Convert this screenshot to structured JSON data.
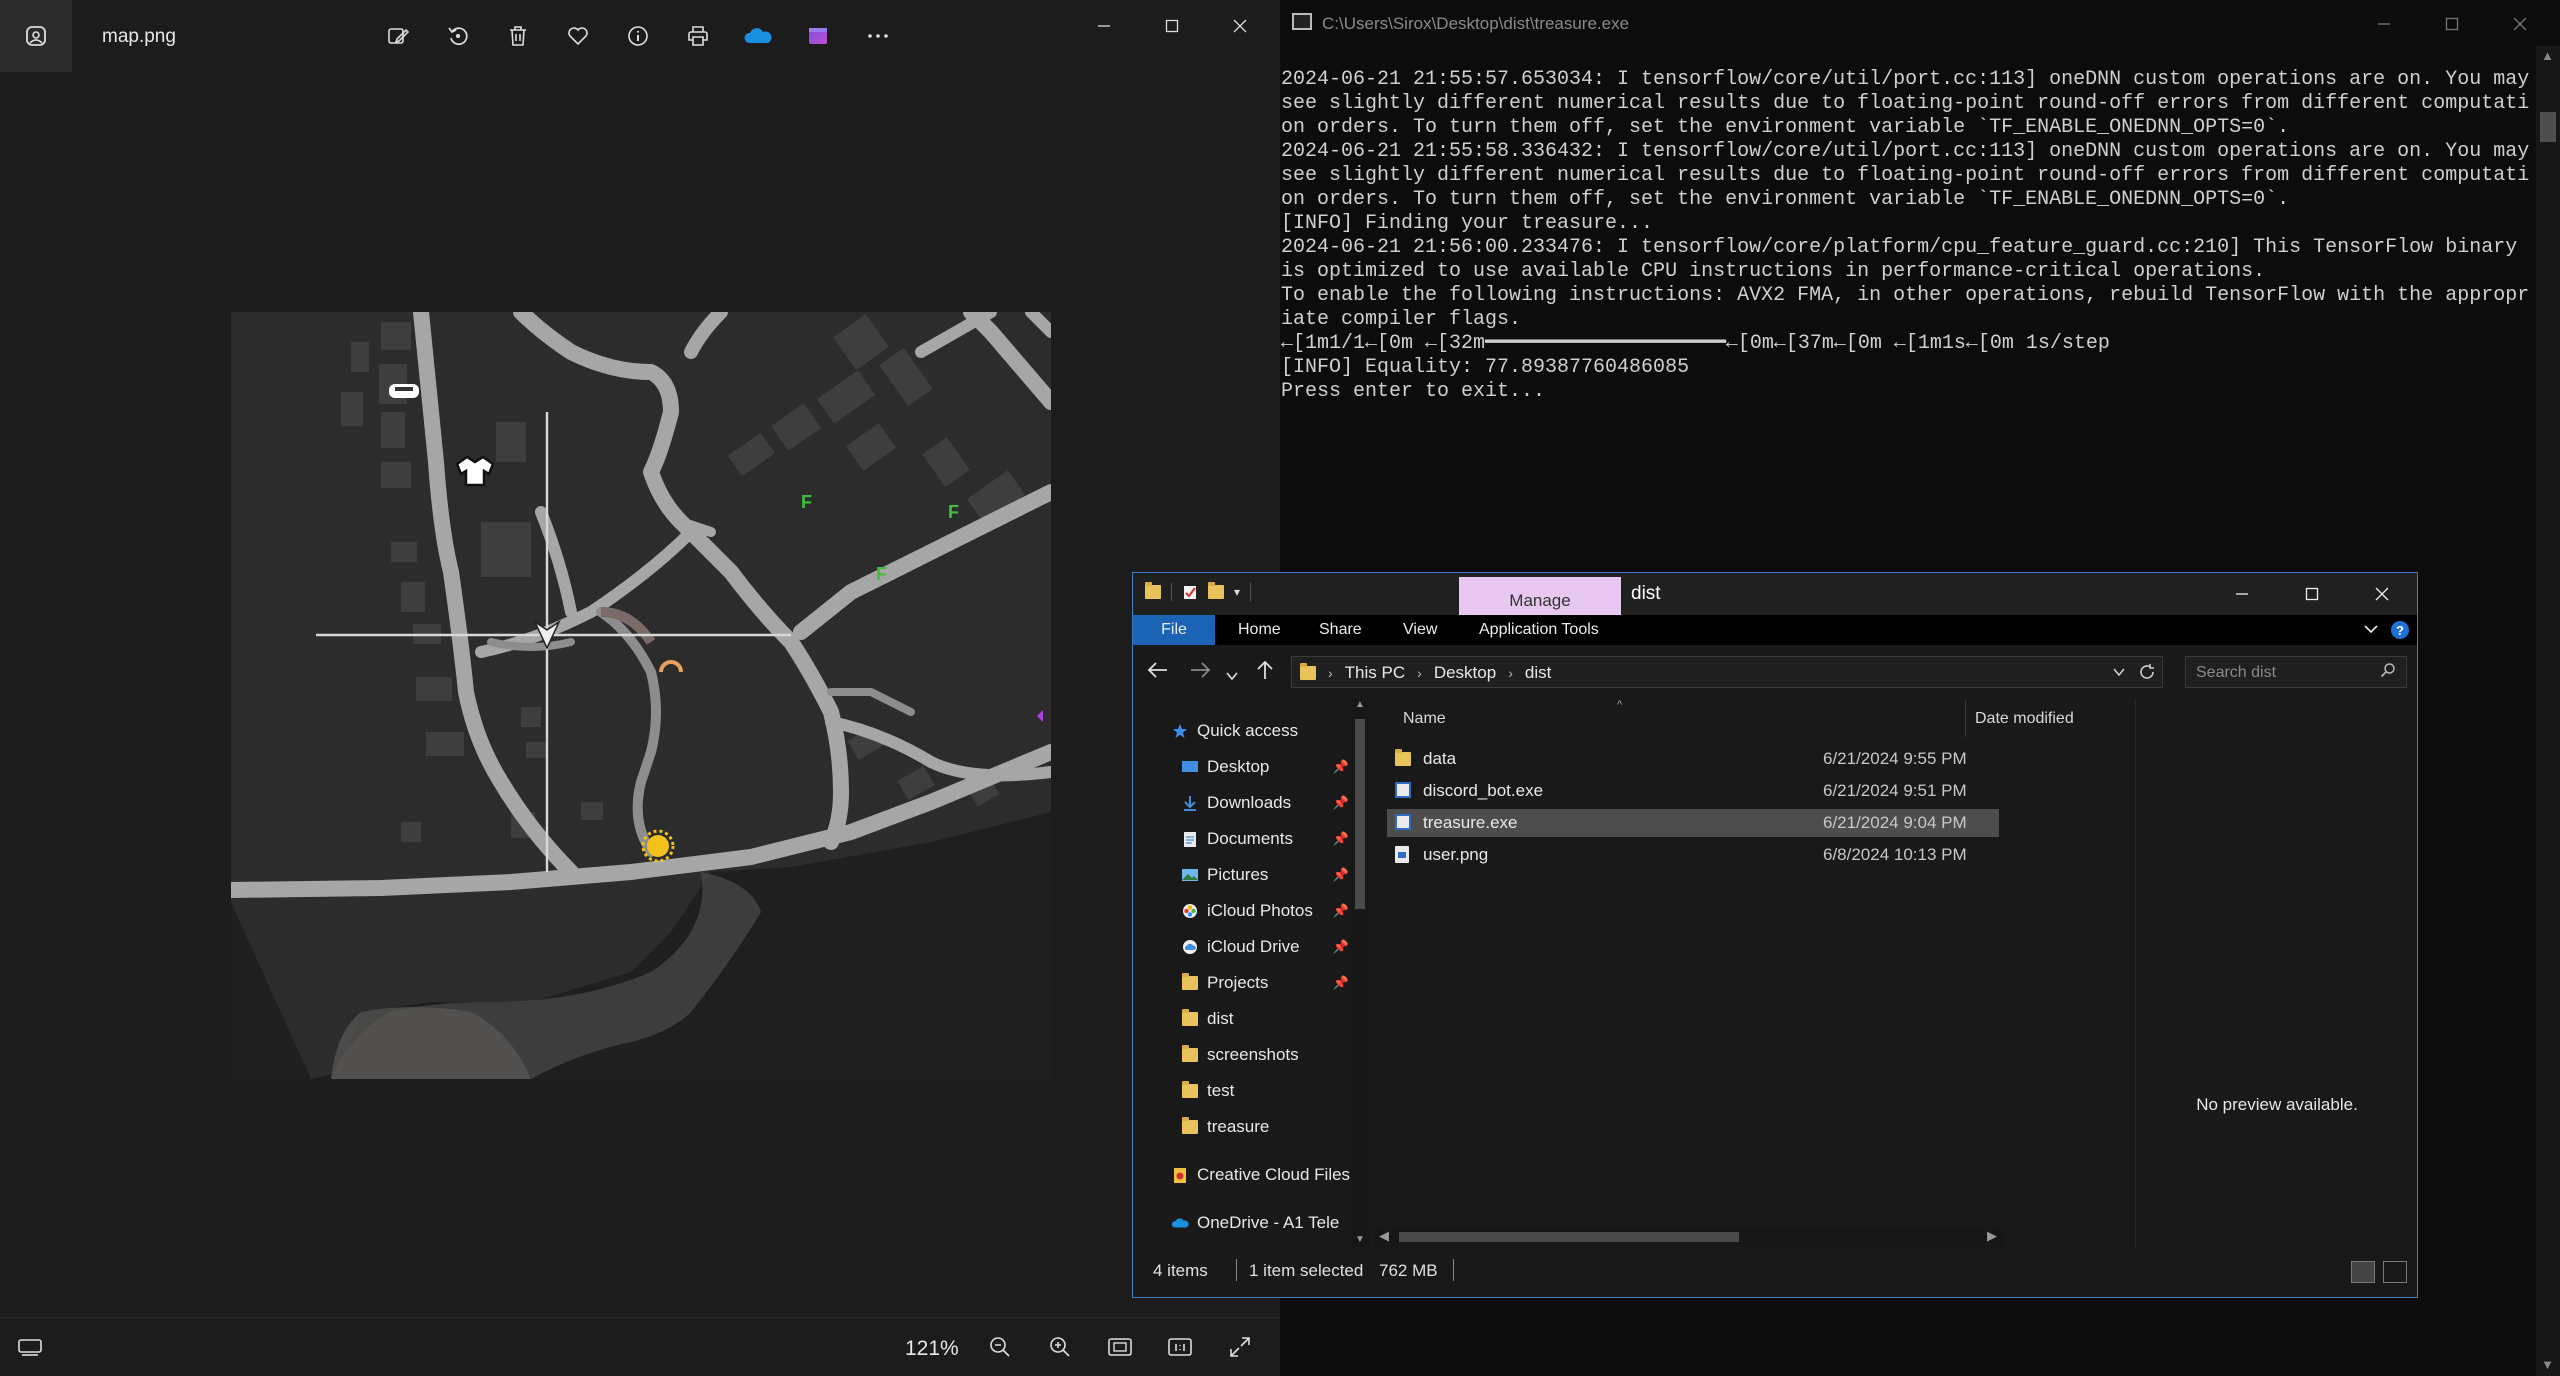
{
  "viewer": {
    "filename": "map.png",
    "zoom": "121%",
    "toolbar_icons": [
      "edit-image-icon",
      "rotate-icon",
      "delete-icon",
      "favorite-icon",
      "info-icon",
      "print-icon",
      "onedrive-icon",
      "clipchamp-icon",
      "more-icon"
    ],
    "bottom_icons": [
      "zoom-out-icon",
      "zoom-in-icon",
      "fit-to-window-icon",
      "actual-size-icon",
      "fullscreen-icon"
    ]
  },
  "console": {
    "title": "C:\\Users\\Sirox\\Desktop\\dist\\treasure.exe",
    "lines": [
      "2024-06-21 21:55:57.653034: I tensorflow/core/util/port.cc:113] oneDNN custom operations are on. You may see slightly different numerical results due to floating-point round-off errors from different computation orders. To turn them off, set the environment variable `TF_ENABLE_ONEDNN_OPTS=0`.",
      "2024-06-21 21:55:58.336432: I tensorflow/core/util/port.cc:113] oneDNN custom operations are on. You may see slightly different numerical results due to floating-point round-off errors from different computation orders. To turn them off, set the environment variable `TF_ENABLE_ONEDNN_OPTS=0`.",
      "[INFO] Finding your treasure...",
      "2024-06-21 21:56:00.233476: I tensorflow/core/platform/cpu_feature_guard.cc:210] This TensorFlow binary is optimized to use available CPU instructions in performance-critical operations.",
      "To enable the following instructions: AVX2 FMA, in other operations, rebuild TensorFlow with the appropriate compiler flags.",
      "←[1m1/1←[0m ←[32m━━━━━━━━━━━━━━━━━━━━←[0m←[37m←[0m ←[1m1s←[0m 1s/step",
      "[INFO] Equality: 77.89387760486085",
      "Press enter to exit..."
    ]
  },
  "explorer": {
    "manage_label": "Manage",
    "window_name": "dist",
    "ribbon_tabs": [
      "File",
      "Home",
      "Share",
      "View",
      "Application Tools"
    ],
    "breadcrumb": [
      "This PC",
      "Desktop",
      "dist"
    ],
    "search_placeholder": "Search dist",
    "columns": {
      "name": "Name",
      "date": "Date modified"
    },
    "sidebar": [
      {
        "label": "Quick access",
        "icon": "star-icon",
        "pinned": false,
        "indent": 0
      },
      {
        "label": "Desktop",
        "icon": "desktop-icon",
        "pinned": true,
        "indent": 1
      },
      {
        "label": "Downloads",
        "icon": "download-icon",
        "pinned": true,
        "indent": 1
      },
      {
        "label": "Documents",
        "icon": "document-icon",
        "pinned": true,
        "indent": 1
      },
      {
        "label": "Pictures",
        "icon": "pictures-icon",
        "pinned": true,
        "indent": 1
      },
      {
        "label": "iCloud Photos",
        "icon": "icloud-photos-icon",
        "pinned": true,
        "indent": 1
      },
      {
        "label": "iCloud Drive",
        "icon": "icloud-drive-icon",
        "pinned": true,
        "indent": 1
      },
      {
        "label": "Projects",
        "icon": "folder-icon",
        "pinned": true,
        "indent": 1
      },
      {
        "label": "dist",
        "icon": "folder-icon",
        "pinned": false,
        "indent": 1
      },
      {
        "label": "screenshots",
        "icon": "folder-icon",
        "pinned": false,
        "indent": 1
      },
      {
        "label": "test",
        "icon": "folder-icon",
        "pinned": false,
        "indent": 1
      },
      {
        "label": "treasure",
        "icon": "folder-icon",
        "pinned": false,
        "indent": 1
      },
      {
        "label": "Creative Cloud Files",
        "icon": "creative-cloud-icon",
        "pinned": false,
        "indent": 0
      },
      {
        "label": "OneDrive - A1 Tele",
        "icon": "onedrive-icon",
        "pinned": false,
        "indent": 0
      }
    ],
    "files": [
      {
        "name": "data",
        "date": "6/21/2024 9:55 PM",
        "type": "folder",
        "selected": false
      },
      {
        "name": "discord_bot.exe",
        "date": "6/21/2024 9:51 PM",
        "type": "exe",
        "selected": false
      },
      {
        "name": "treasure.exe",
        "date": "6/21/2024 9:04 PM",
        "type": "exe",
        "selected": true
      },
      {
        "name": "user.png",
        "date": "6/8/2024 10:13 PM",
        "type": "png",
        "selected": false
      }
    ],
    "preview_text": "No preview available.",
    "status": {
      "items": "4 items",
      "selected": "1 item selected",
      "size": "762 MB"
    }
  },
  "map": {
    "markers": [
      {
        "label": "F",
        "color": "#3ec03e"
      },
      {
        "label": "F",
        "color": "#3ec03e"
      },
      {
        "label": "F",
        "color": "#3ec03e"
      }
    ]
  }
}
